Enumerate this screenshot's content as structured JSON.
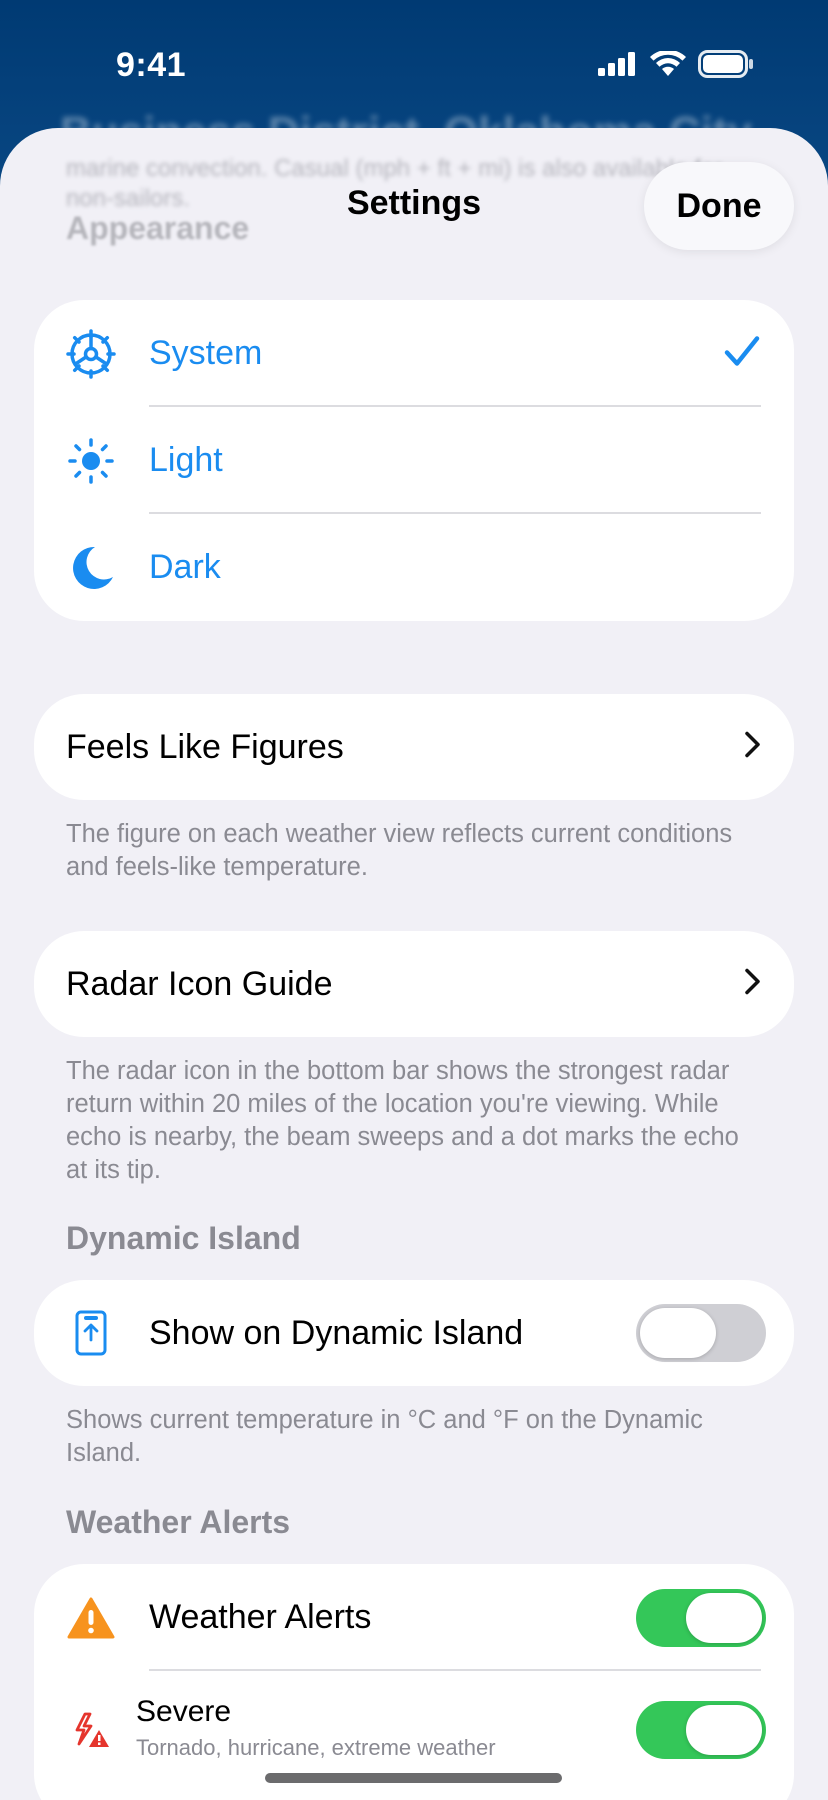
{
  "status_bar": {
    "time": "9:41"
  },
  "backdrop": {
    "title": "Business District, Oklahoma City"
  },
  "sheet": {
    "ghost_text": "marine convection. Casual (mph + ft + mi) is also available for non-sailors.",
    "title": "Settings",
    "done_label": "Done"
  },
  "appearance": {
    "header": "Appearance",
    "options": [
      {
        "label": "System",
        "icon": "gear-icon",
        "selected": true
      },
      {
        "label": "Light",
        "icon": "sun-icon",
        "selected": false
      },
      {
        "label": "Dark",
        "icon": "moon-icon",
        "selected": false
      }
    ]
  },
  "feels_like": {
    "label": "Feels Like Figures",
    "footnote": "The figure on each weather view reflects current conditions and feels-like temperature."
  },
  "radar_guide": {
    "label": "Radar Icon Guide",
    "footnote": "The radar icon in the bottom bar shows the strongest radar return within 20 miles of the location you're viewing. While echo is nearby, the beam sweeps and a dot marks the echo at its tip."
  },
  "dynamic_island": {
    "header": "Dynamic Island",
    "toggle_label": "Show on Dynamic Island",
    "toggle_on": false,
    "footnote": "Shows current temperature in °C and °F on the Dynamic Island."
  },
  "weather_alerts": {
    "header": "Weather Alerts",
    "main_label": "Weather Alerts",
    "main_on": true,
    "severe_title": "Severe",
    "severe_subtitle": "Tornado, hurricane, extreme weather",
    "severe_on": true
  },
  "colors": {
    "accent": "#1a8cf0",
    "toggle_on": "#34c759",
    "warning": "#f7931e",
    "severe": "#e5352d"
  }
}
